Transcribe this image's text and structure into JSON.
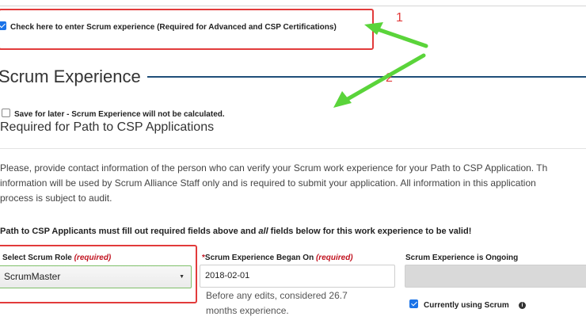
{
  "scrum_checkbox": {
    "label": "Check here to enter Scrum experience (Required for Advanced and CSP Certifications)",
    "checked": true
  },
  "section": {
    "title": "Scrum Experience"
  },
  "save_later": {
    "label": "Save for later - Scrum Experience will not be calculated.",
    "checked": false
  },
  "subheading": "Required for Path to CSP Applications",
  "instructions": {
    "line1": "Please, provide contact information of the person who can verify your Scrum work experience for your Path to CSP Application. Th",
    "line2": "information will be used by Scrum Alliance Staff only and is required to submit your application. All information in this application",
    "line3": "process is subject to audit."
  },
  "applicants_note": {
    "before": "Path to CSP Applicants must fill out required fields above and ",
    "emphasis": "all",
    "after": " fields below for this work experience to be valid!"
  },
  "role": {
    "label": "Select Scrum Role",
    "required": "(required)",
    "value": "ScrumMaster"
  },
  "began": {
    "asterisk": "*",
    "label": "Scrum Experience Began On",
    "required": "(required)",
    "value": "2018-02-01",
    "hint": "Before any edits, considered 26.7 months experience."
  },
  "ongoing": {
    "label": "Scrum Experience is Ongoing",
    "currently_label": "Currently using Scrum",
    "currently_checked": true,
    "info_icon": "i"
  },
  "annotations": {
    "callout1": "1",
    "callout2": "2",
    "color": "#e23b3b",
    "arrow_color": "#5ad43a"
  },
  "colors": {
    "section_rule": "#1f4e79",
    "required": "#c1121f",
    "checkbox": "#1a73e8"
  }
}
